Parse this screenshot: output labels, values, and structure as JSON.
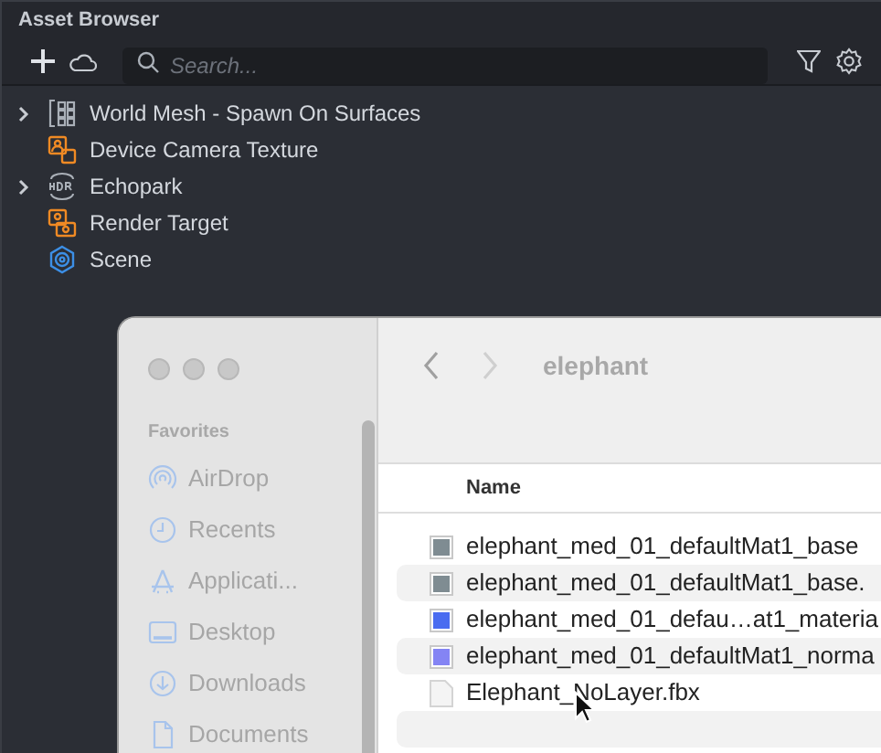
{
  "panel": {
    "title": "Asset Browser",
    "search": {
      "placeholder": "Search..."
    },
    "items": [
      {
        "label": "World Mesh - Spawn On Surfaces",
        "kind": "mesh",
        "has_children": true
      },
      {
        "label": "Device Camera Texture",
        "kind": "camera",
        "has_children": false
      },
      {
        "label": "Echopark",
        "kind": "hdr",
        "has_children": true
      },
      {
        "label": "Render Target",
        "kind": "render",
        "has_children": false
      },
      {
        "label": "Scene",
        "kind": "scene",
        "has_children": false
      }
    ]
  },
  "finder": {
    "title": "elephant",
    "sidebar_heading": "Favorites",
    "sidebar": [
      {
        "label": "AirDrop",
        "kind": "airdrop"
      },
      {
        "label": "Recents",
        "kind": "clock"
      },
      {
        "label": "Applicati...",
        "kind": "apps"
      },
      {
        "label": "Desktop",
        "kind": "desktop"
      },
      {
        "label": "Downloads",
        "kind": "download"
      },
      {
        "label": "Documents",
        "kind": "document"
      }
    ],
    "column": "Name",
    "files": [
      {
        "name": "elephant_med_01_defaultMat1_base",
        "kind": "image",
        "color": "#7f8c92"
      },
      {
        "name": "elephant_med_01_defaultMat1_base.",
        "kind": "image",
        "color": "#7f8c92"
      },
      {
        "name": "elephant_med_01_defau…at1_materia",
        "kind": "image",
        "color": "#4a6cf0"
      },
      {
        "name": "elephant_med_01_defaultMat1_norma",
        "kind": "image",
        "color": "#8484f4"
      },
      {
        "name": "Elephant_NoLayer.fbx",
        "kind": "document"
      }
    ]
  }
}
